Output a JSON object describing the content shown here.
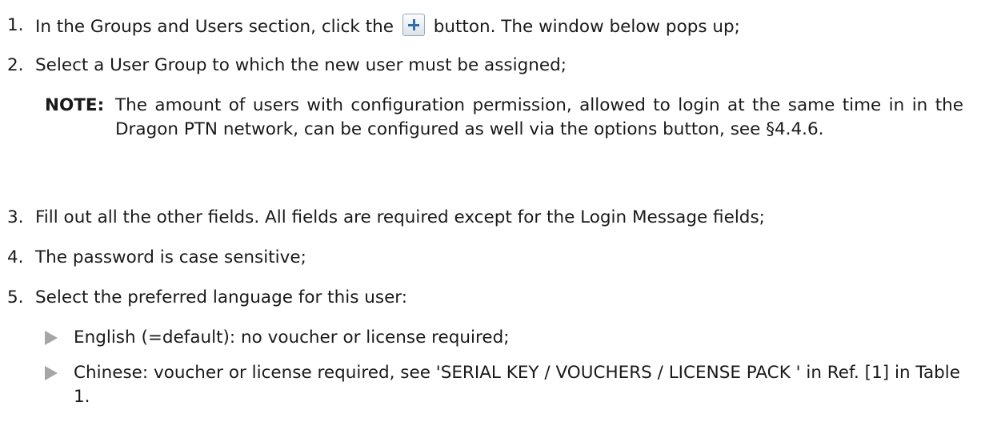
{
  "steps": [
    {
      "num": "1.",
      "before": "In the Groups and Users section, click the",
      "after": "button. The window below pops up;"
    },
    {
      "num": "2.",
      "text": "Select a User Group to which the new user must be assigned;"
    },
    {
      "num": "3.",
      "text": "Fill out all the other fields. All fields are required except for the Login Message fields;"
    },
    {
      "num": "4.",
      "text": "The password is case sensitive;"
    },
    {
      "num": "5.",
      "text": "Select the preferred language for this user:"
    }
  ],
  "note": {
    "label": "NOTE:",
    "text": "The amount of users with configuration permission, allowed to login at the same time in in the Dragon PTN network, can be configured as well via the options button, see §4.4.6."
  },
  "bullets": [
    "English (=default): no voucher or license required;",
    "Chinese: voucher or license required, see 'SERIAL KEY / VOUCHERS / LICENSE PACK ' in Ref. [1] in Table 1."
  ],
  "icons": {
    "add": "plus-icon"
  }
}
